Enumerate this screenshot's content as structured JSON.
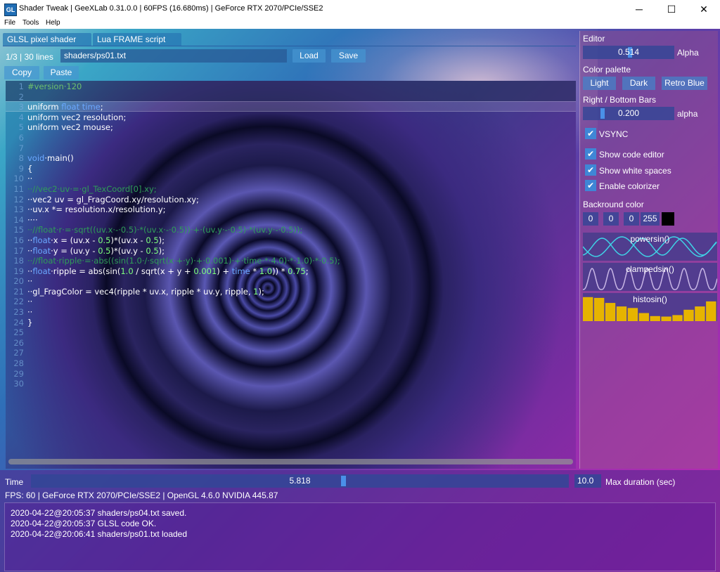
{
  "window": {
    "title": "Shader Tweak | GeeXLab 0.31.0.0 | 60FPS (16.680ms) | GeForce RTX 2070/PCIe/SSE2",
    "icon_text": "GL",
    "minimize": "─",
    "maximize": "☐",
    "close": "✕"
  },
  "menu": {
    "file": "File",
    "tools": "Tools",
    "help": "Help"
  },
  "tabs": {
    "glsl": "GLSL pixel shader",
    "lua": "Lua FRAME script"
  },
  "editor_toolbar": {
    "lines_info": "1/3 | 30 lines",
    "path": "shaders/ps01.txt",
    "load": "Load",
    "save": "Save",
    "copy": "Copy",
    "paste": "Paste"
  },
  "code_lines": [
    {
      "n": "1",
      "html": "<span class='c-dir'>#version·120</span>"
    },
    {
      "n": "2",
      "html": ""
    },
    {
      "n": "3",
      "html": "uniform <span class='c-kw'>float</span> <span class='c-kw'>time</span>;"
    },
    {
      "n": "4",
      "html": "uniform vec2 resolution;"
    },
    {
      "n": "5",
      "html": "uniform vec2 mouse;"
    },
    {
      "n": "6",
      "html": ""
    },
    {
      "n": "7",
      "html": ""
    },
    {
      "n": "8",
      "html": "<span class='c-kw'>void</span>·main()"
    },
    {
      "n": "9",
      "html": "{"
    },
    {
      "n": "10",
      "html": "··"
    },
    {
      "n": "11",
      "html": "<span class='c-cm'>··//vec2·uv·=·gl_TexCoord[0].xy;</span>"
    },
    {
      "n": "12",
      "html": "··vec2 uv = gl_FragCoord.xy/resolution.xy;"
    },
    {
      "n": "13",
      "html": "··uv.x *= resolution.x/resolution.y;"
    },
    {
      "n": "14",
      "html": "····"
    },
    {
      "n": "15",
      "html": "<span class='c-cm'>··//float·r·=·sqrt((uv.x·-·0.5)·*(uv.x·-·0.5))·+·(uv.y·-·0.5)·*(uv.y·-·0.5));</span>"
    },
    {
      "n": "16",
      "html": "··<span class='c-kw'>float</span>·x = (uv.x - <span class='c-num'>0.5</span>)*(uv.x - <span class='c-num'>0.5</span>);"
    },
    {
      "n": "17",
      "html": "··<span class='c-kw'>float</span>·y = (uv.y - <span class='c-num'>0.5</span>)*(uv.y - <span class='c-num'>0.5</span>);"
    },
    {
      "n": "18",
      "html": "<span class='c-cm'>··//float·ripple·=·abs((sin(1.0·/·sqrt(x·+·y)·+·0.001)·+·time·*·4.0)·*·1.0)·*·0.5);</span>"
    },
    {
      "n": "19",
      "html": "··<span class='c-kw'>float</span>·ripple = abs(sin(<span class='c-num'>1.0</span> / sqrt(x + y + <span class='c-num'>0.001</span>) + <span class='c-kw'>time</span> * <span class='c-num'>1.0</span>)) * <span class='c-num'>0.75</span>;"
    },
    {
      "n": "20",
      "html": "··"
    },
    {
      "n": "21",
      "html": "··gl_FragColor = vec4(ripple * uv.x, ripple * uv.y, ripple, <span class='c-num'>1</span>);"
    },
    {
      "n": "22",
      "html": "··"
    },
    {
      "n": "23",
      "html": "··"
    },
    {
      "n": "24",
      "html": "}"
    },
    {
      "n": "25",
      "html": ""
    },
    {
      "n": "26",
      "html": ""
    },
    {
      "n": "27",
      "html": ""
    },
    {
      "n": "28",
      "html": ""
    },
    {
      "n": "29",
      "html": ""
    },
    {
      "n": "30",
      "html": ""
    }
  ],
  "right_panel": {
    "editor_label": "Editor",
    "alpha_value": "0.514",
    "alpha_fraction": 0.514,
    "alpha_label": "Alpha",
    "palette_label": "Color palette",
    "palette_light": "Light",
    "palette_dark": "Dark",
    "palette_retro": "Retro Blue",
    "bars_label": "Right / Bottom Bars",
    "bars_value": "0.200",
    "bars_fraction": 0.2,
    "bars_alpha_label": "alpha",
    "vsync": "VSYNC",
    "show_code_editor": "Show code editor",
    "show_white_spaces": "Show white spaces",
    "enable_colorizer": "Enable colorizer",
    "bg_label": "Backround color",
    "bg_r": "0",
    "bg_g": "0",
    "bg_b": "0",
    "bg_a": "255",
    "bg_swatch_color": "#000000",
    "graph1": "powersin()",
    "graph2": "clampedsin()",
    "graph3": "histosin()",
    "histo_color": "#e6b400",
    "wave_color": "#3fd2e6",
    "histo_values": [
      0.95,
      0.92,
      0.72,
      0.58,
      0.52,
      0.32,
      0.2,
      0.18,
      0.24,
      0.45,
      0.58,
      0.78
    ]
  },
  "bottom": {
    "time_label": "Time",
    "time_value": "5.818",
    "time_fraction": 0.5818,
    "max_value": "10.0",
    "max_label": "Max duration (sec)",
    "fps_line": "FPS: 60 | GeForce RTX 2070/PCIe/SSE2 | OpenGL 4.6.0 NVIDIA 445.87",
    "log": [
      "2020-04-22@20:05:37 shaders/ps04.txt saved.",
      "2020-04-22@20:05:37 GLSL code OK.",
      "2020-04-22@20:06:41 shaders/ps01.txt loaded"
    ]
  }
}
